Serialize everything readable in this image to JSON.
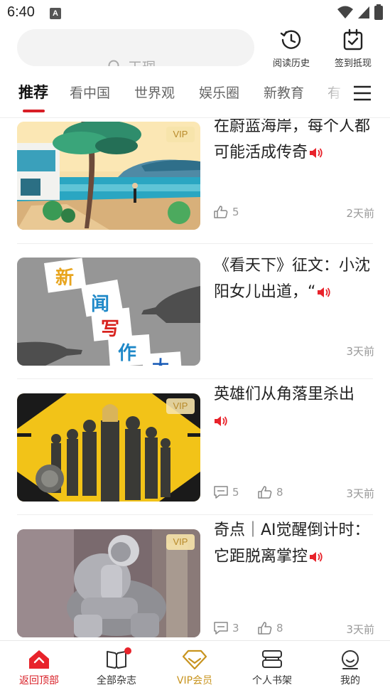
{
  "status_bar": {
    "time": "6:40",
    "notification": "A"
  },
  "search": {
    "placeholder": "王珮"
  },
  "top_actions": [
    {
      "label": "阅读历史",
      "icon": "history-clock-icon"
    },
    {
      "label": "签到抵现",
      "icon": "checkin-calendar-icon"
    }
  ],
  "tabs": [
    "推荐",
    "看中国",
    "世界观",
    "娱乐圈",
    "新教育",
    "有"
  ],
  "articles": [
    {
      "title": "在蔚蓝海岸，每个人都可能活成传奇",
      "vip": "VIP",
      "comments": "",
      "likes": "5",
      "time": "2天前"
    },
    {
      "title": "《看天下》征文：小沈阳女儿出道，“",
      "vip": "",
      "comments": "",
      "likes": "",
      "time": "3天前",
      "thumb_words": [
        "新",
        "闻",
        "写",
        "作",
        "大"
      ]
    },
    {
      "title": "英雄们从角落里杀出",
      "vip": "VIP",
      "comments": "5",
      "likes": "8",
      "time": "3天前"
    },
    {
      "title": "奇点｜AI觉醒倒计时：它距脱离掌控",
      "vip": "VIP",
      "comments": "3",
      "likes": "8",
      "time": "3天前"
    }
  ],
  "bottom_nav": [
    {
      "label": "返回顶部",
      "icon": "home-top-icon",
      "active": true
    },
    {
      "label": "全部杂志",
      "icon": "magazine-icon",
      "badge": true
    },
    {
      "label": "VIP会员",
      "icon": "vip-diamond-icon"
    },
    {
      "label": "个人书架",
      "icon": "bookshelf-icon"
    },
    {
      "label": "我的",
      "icon": "profile-smile-icon"
    }
  ],
  "colors": {
    "accent": "#d81e26",
    "vip_gold": "#c8941f",
    "vip_badge_bg": "#f6e3aa",
    "text": "#222222",
    "muted": "#999999"
  }
}
